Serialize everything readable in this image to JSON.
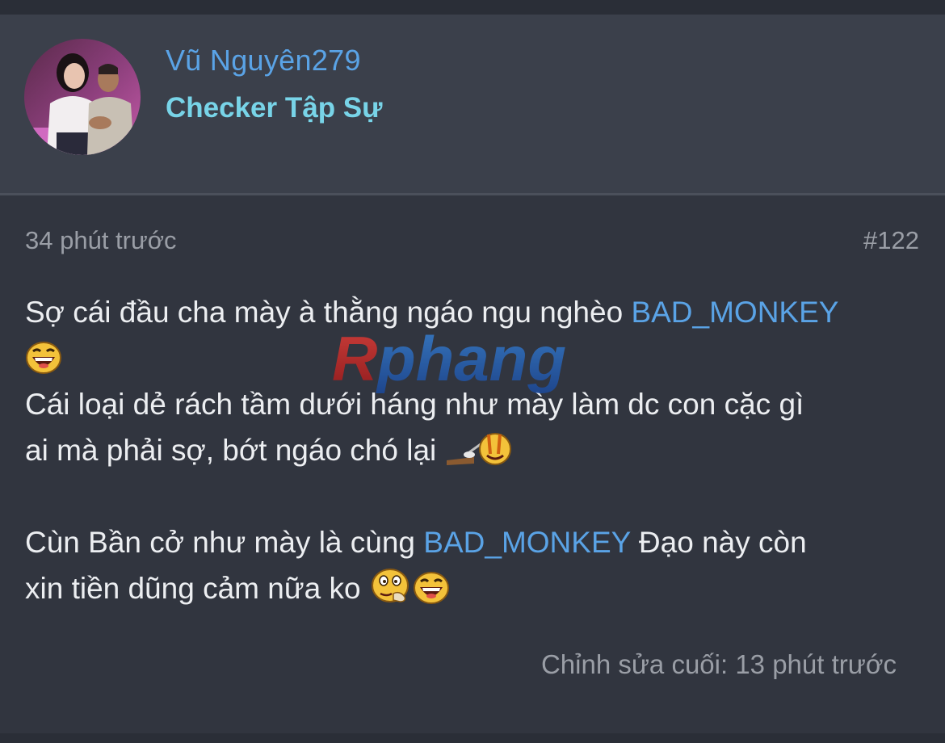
{
  "user": {
    "name": "Vũ Nguyên279",
    "title": "Checker Tập Sự"
  },
  "post": {
    "time": "34 phút trước",
    "number": "#122",
    "line1_text": "Sợ cái đầu cha mày à thằng ngáo ngu nghèo ",
    "line1_mention": "BAD_MONKEY",
    "line3_text": "Cái loại dẻ rách tầm dưới háng như mày làm dc con cặc gì",
    "line4_text": "ai mà phải sợ, bớt ngáo chó lại ",
    "line6_text": "Cùn Bần cở như mày là cùng ",
    "line6_mention": "BAD_MONKEY",
    "line6_after": " Đạo này còn",
    "line7_text": "xin tiền dũng cảm nữa ko ",
    "edited": "Chỉnh sửa cuối: 13 phút trước"
  },
  "watermark": {
    "text": "Rphang"
  },
  "colors": {
    "background": "#2a2e37",
    "header_bg": "#3b404b",
    "post_bg": "#31353f",
    "link": "#5aa3e6",
    "user_title": "#78d4e8",
    "text": "#eceef1",
    "muted": "#9a9ea6"
  },
  "icons": {
    "emoji_1": "laughing-emoji-icon",
    "emoji_2": "sweeping-emoji-icon",
    "emoji_3": "thinking-emoji-icon",
    "emoji_4": "laughing-emoji-icon"
  }
}
